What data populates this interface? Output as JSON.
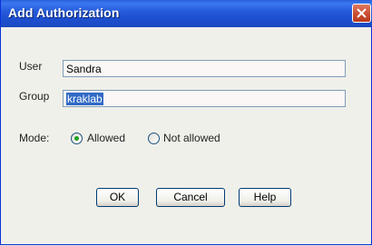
{
  "window": {
    "title": "Add Authorization"
  },
  "form": {
    "user_label": "User",
    "user_value": "Sandra",
    "group_label": "Group",
    "group_value": "kraklab",
    "mode_label": "Mode:",
    "mode_options": [
      "Allowed",
      "Not allowed"
    ],
    "mode_selected": "Allowed"
  },
  "buttons": {
    "ok": "OK",
    "cancel": "Cancel",
    "help": "Help"
  },
  "colors": {
    "titlebar": "#2458d8",
    "close": "#c94a2c",
    "selection": "#316ac5"
  },
  "icons": {
    "close": "close-icon"
  }
}
